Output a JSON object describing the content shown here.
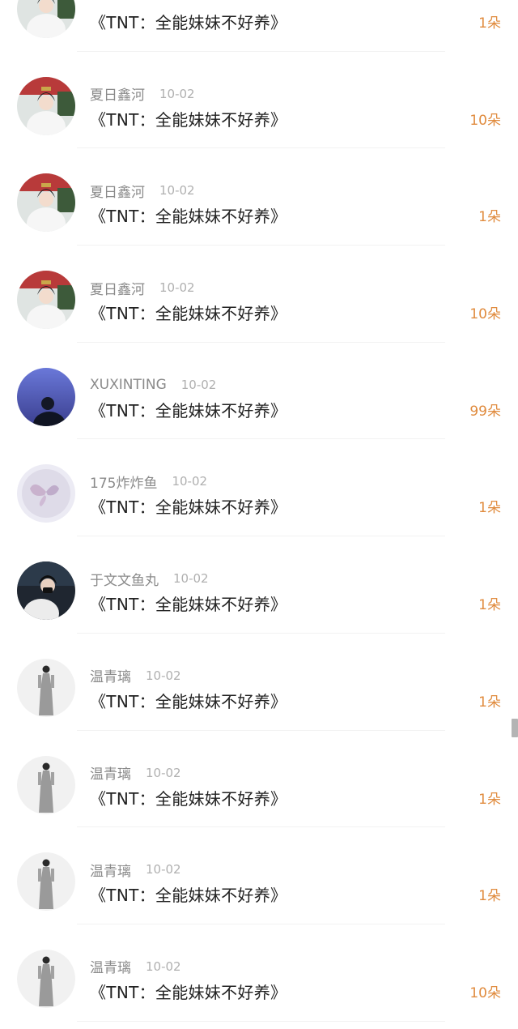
{
  "rows": [
    {
      "avatar": "avatar-hanfu",
      "user": "",
      "date": "",
      "work": "《TNT：全能妹妹不好养》",
      "amount": "1朵"
    },
    {
      "avatar": "avatar-hanfu",
      "user": "夏日鑫河",
      "date": "10-02",
      "work": "《TNT：全能妹妹不好养》",
      "amount": "10朵"
    },
    {
      "avatar": "avatar-hanfu",
      "user": "夏日鑫河",
      "date": "10-02",
      "work": "《TNT：全能妹妹不好养》",
      "amount": "1朵"
    },
    {
      "avatar": "avatar-hanfu",
      "user": "夏日鑫河",
      "date": "10-02",
      "work": "《TNT：全能妹妹不好养》",
      "amount": "10朵"
    },
    {
      "avatar": "avatar-night-sky",
      "user": "XUXINTING",
      "date": "10-02",
      "work": "《TNT：全能妹妹不好养》",
      "amount": "99朵"
    },
    {
      "avatar": "avatar-butterfly",
      "user": "175炸炸鱼",
      "date": "10-02",
      "work": "《TNT：全能妹妹不好养》",
      "amount": "1朵"
    },
    {
      "avatar": "avatar-dark-photo",
      "user": "于文文鱼丸",
      "date": "10-02",
      "work": "《TNT：全能妹妹不好养》",
      "amount": "1朵"
    },
    {
      "avatar": "avatar-grey-dress",
      "user": "温青璃",
      "date": "10-02",
      "work": "《TNT：全能妹妹不好养》",
      "amount": "1朵"
    },
    {
      "avatar": "avatar-grey-dress",
      "user": "温青璃",
      "date": "10-02",
      "work": "《TNT：全能妹妹不好养》",
      "amount": "1朵"
    },
    {
      "avatar": "avatar-grey-dress",
      "user": "温青璃",
      "date": "10-02",
      "work": "《TNT：全能妹妹不好养》",
      "amount": "1朵"
    },
    {
      "avatar": "avatar-grey-dress",
      "user": "温青璃",
      "date": "10-02",
      "work": "《TNT：全能妹妹不好养》",
      "amount": "10朵"
    }
  ],
  "colors": {
    "amount": "#e08b3e",
    "username": "#8a8a8a",
    "date": "#b0b0b0",
    "work": "#222222"
  }
}
